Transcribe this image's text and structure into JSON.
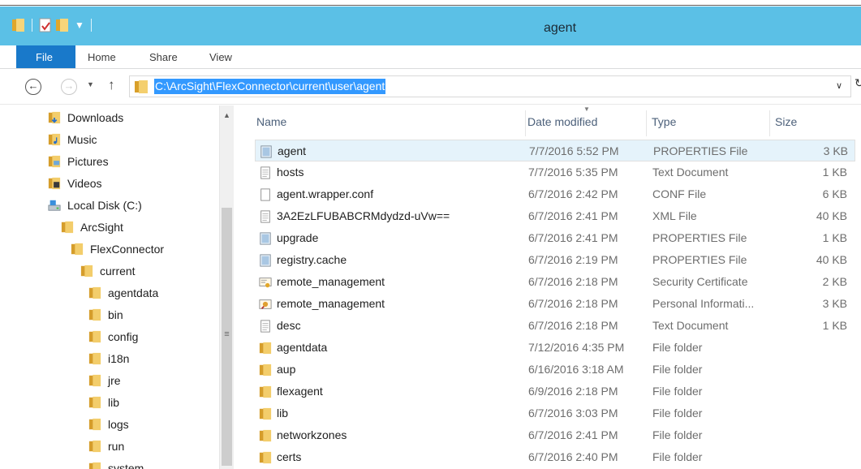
{
  "window": {
    "title": "agent"
  },
  "ribbon": {
    "tabs": [
      "File",
      "Home",
      "Share",
      "View"
    ]
  },
  "address": {
    "path": "C:\\ArcSight\\FlexConnector\\current\\user\\agent",
    "back_icon": "back-arrow-icon",
    "forward_icon": "forward-arrow-icon",
    "up_icon": "up-arrow-icon"
  },
  "nav_pane": {
    "items": [
      {
        "label": "Downloads",
        "icon": "downloads-icon",
        "indent": 0
      },
      {
        "label": "Music",
        "icon": "music-icon",
        "indent": 0
      },
      {
        "label": "Pictures",
        "icon": "pictures-icon",
        "indent": 0
      },
      {
        "label": "Videos",
        "icon": "videos-icon",
        "indent": 0
      },
      {
        "label": "Local Disk (C:)",
        "icon": "drive-icon",
        "indent": 0
      },
      {
        "label": "ArcSight",
        "icon": "folder-icon",
        "indent": 1
      },
      {
        "label": "FlexConnector",
        "icon": "folder-icon",
        "indent": 2
      },
      {
        "label": "current",
        "icon": "folder-icon",
        "indent": 3
      },
      {
        "label": "agentdata",
        "icon": "folder-icon",
        "indent": 4
      },
      {
        "label": "bin",
        "icon": "folder-icon",
        "indent": 4
      },
      {
        "label": "config",
        "icon": "folder-icon",
        "indent": 4
      },
      {
        "label": "i18n",
        "icon": "folder-icon",
        "indent": 4
      },
      {
        "label": "jre",
        "icon": "folder-icon",
        "indent": 4
      },
      {
        "label": "lib",
        "icon": "folder-icon",
        "indent": 4
      },
      {
        "label": "logs",
        "icon": "folder-icon",
        "indent": 4
      },
      {
        "label": "run",
        "icon": "folder-icon",
        "indent": 4
      },
      {
        "label": "system",
        "icon": "folder-icon",
        "indent": 4
      }
    ]
  },
  "file_list": {
    "columns": [
      "Name",
      "Date modified",
      "Type",
      "Size"
    ],
    "rows": [
      {
        "name": "agent",
        "date": "7/7/2016 5:52 PM",
        "type": "PROPERTIES File",
        "size": "3 KB",
        "icon": "properties-file-icon",
        "selected": true
      },
      {
        "name": "hosts",
        "date": "7/7/2016 5:35 PM",
        "type": "Text Document",
        "size": "1 KB",
        "icon": "text-file-icon",
        "selected": false
      },
      {
        "name": "agent.wrapper.conf",
        "date": "6/7/2016 2:42 PM",
        "type": "CONF File",
        "size": "6 KB",
        "icon": "blank-file-icon",
        "selected": false
      },
      {
        "name": "3A2EzLFUBABCRMdydzd-uVw==",
        "date": "6/7/2016 2:41 PM",
        "type": "XML File",
        "size": "40 KB",
        "icon": "text-file-icon",
        "selected": false
      },
      {
        "name": "upgrade",
        "date": "6/7/2016 2:41 PM",
        "type": "PROPERTIES File",
        "size": "1 KB",
        "icon": "properties-file-icon",
        "selected": false
      },
      {
        "name": "registry.cache",
        "date": "6/7/2016 2:19 PM",
        "type": "PROPERTIES File",
        "size": "40 KB",
        "icon": "properties-file-icon",
        "selected": false
      },
      {
        "name": "remote_management",
        "date": "6/7/2016 2:18 PM",
        "type": "Security Certificate",
        "size": "2 KB",
        "icon": "certificate-icon",
        "selected": false
      },
      {
        "name": "remote_management",
        "date": "6/7/2016 2:18 PM",
        "type": "Personal Informati...",
        "size": "3 KB",
        "icon": "personal-info-icon",
        "selected": false
      },
      {
        "name": "desc",
        "date": "6/7/2016 2:18 PM",
        "type": "Text Document",
        "size": "1 KB",
        "icon": "text-file-icon",
        "selected": false
      },
      {
        "name": "agentdata",
        "date": "7/12/2016 4:35 PM",
        "type": "File folder",
        "size": "",
        "icon": "folder-icon",
        "selected": false
      },
      {
        "name": "aup",
        "date": "6/16/2016 3:18 AM",
        "type": "File folder",
        "size": "",
        "icon": "folder-icon",
        "selected": false
      },
      {
        "name": "flexagent",
        "date": "6/9/2016 2:18 PM",
        "type": "File folder",
        "size": "",
        "icon": "folder-icon",
        "selected": false
      },
      {
        "name": "lib",
        "date": "6/7/2016 3:03 PM",
        "type": "File folder",
        "size": "",
        "icon": "folder-icon",
        "selected": false
      },
      {
        "name": "networkzones",
        "date": "6/7/2016 2:41 PM",
        "type": "File folder",
        "size": "",
        "icon": "folder-icon",
        "selected": false
      },
      {
        "name": "certs",
        "date": "6/7/2016 2:40 PM",
        "type": "File folder",
        "size": "",
        "icon": "folder-icon",
        "selected": false
      }
    ]
  },
  "colors": {
    "title_bar": "#5bc0e6",
    "file_tab": "#1979ca",
    "address_highlight": "#3399ff",
    "folder": "#e8b94a",
    "selected_row": "#e5f3fb"
  }
}
